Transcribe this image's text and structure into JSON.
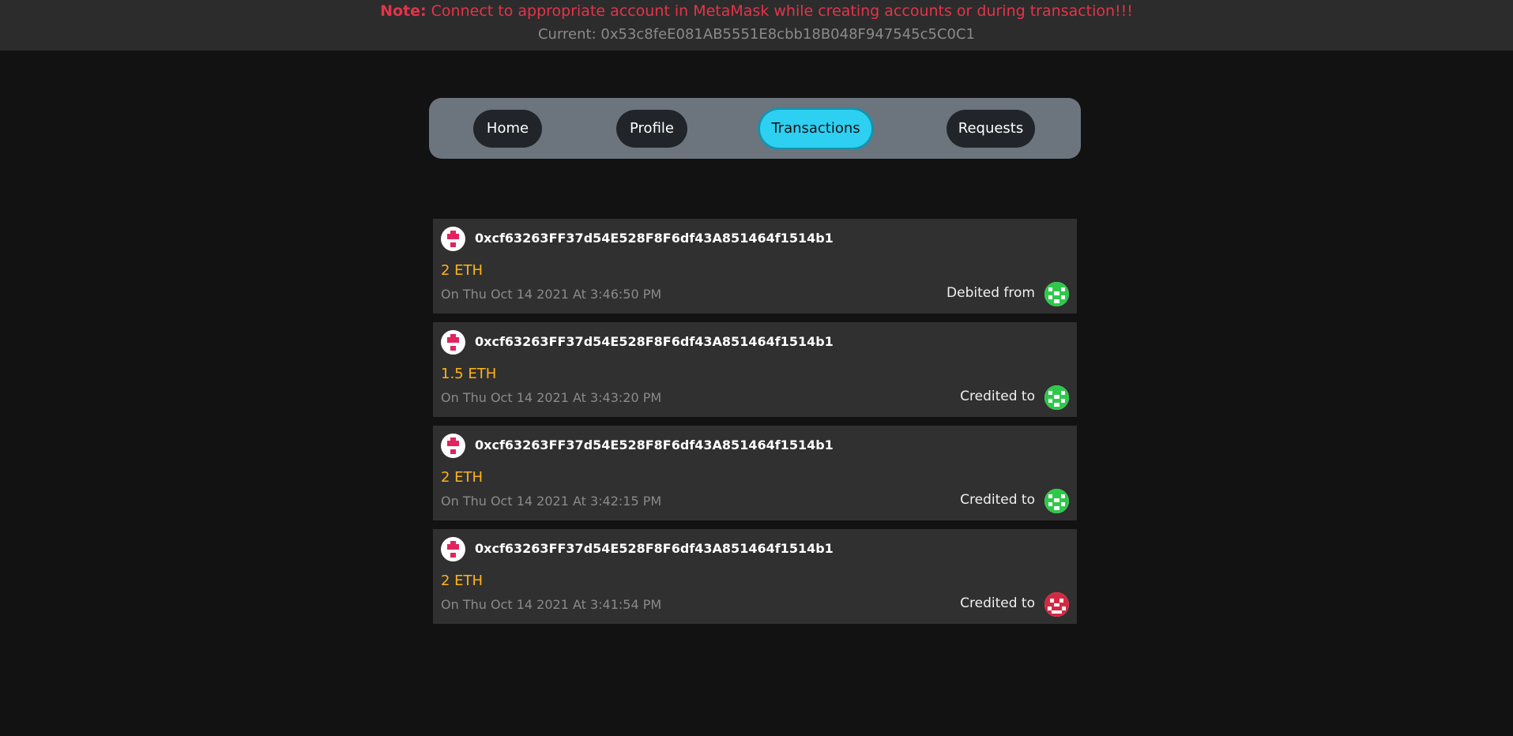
{
  "banner": {
    "note_label": "Note:",
    "note_text": "Connect to appropriate account in MetaMask while creating accounts or during transaction!!!",
    "current_label": "Current:",
    "current_address": "0x53c8feE081AB5551E8cbb18B048F947545c5C0C1"
  },
  "nav": {
    "items": [
      {
        "label": "Home",
        "active": false
      },
      {
        "label": "Profile",
        "active": false
      },
      {
        "label": "Transactions",
        "active": true
      },
      {
        "label": "Requests",
        "active": false
      }
    ]
  },
  "transactions": [
    {
      "address": "0xcf63263FF37d54E528F8F6df43A851464f1514b1",
      "amount": "2 ETH",
      "date": "On Thu Oct 14 2021 At 3:46:50 PM",
      "direction": "Debited from",
      "avatar_icon": "identicon-pink",
      "counterparty_icon": "identicon-green"
    },
    {
      "address": "0xcf63263FF37d54E528F8F6df43A851464f1514b1",
      "amount": "1.5 ETH",
      "date": "On Thu Oct 14 2021 At 3:43:20 PM",
      "direction": "Credited to",
      "avatar_icon": "identicon-pink",
      "counterparty_icon": "identicon-green"
    },
    {
      "address": "0xcf63263FF37d54E528F8F6df43A851464f1514b1",
      "amount": "2 ETH",
      "date": "On Thu Oct 14 2021 At 3:42:15 PM",
      "direction": "Credited to",
      "avatar_icon": "identicon-pink",
      "counterparty_icon": "identicon-green"
    },
    {
      "address": "0xcf63263FF37d54E528F8F6df43A851464f1514b1",
      "amount": "2 ETH",
      "date": "On Thu Oct 14 2021 At 3:41:54 PM",
      "direction": "Credited to",
      "avatar_icon": "identicon-pink",
      "counterparty_icon": "identicon-red"
    }
  ],
  "colors": {
    "background": "#121212",
    "banner_bg": "#2c2c2c",
    "note": "#e3344a",
    "nav_bg": "#6c757d",
    "pill_bg": "#212529",
    "pill_active": "#2ed0f2",
    "card_bg": "#303030",
    "amount": "#ffb31a",
    "muted": "#8a8a8a",
    "identicon_pink": "#e0245e",
    "identicon_green": "#2ec94a",
    "identicon_red": "#d62840"
  }
}
